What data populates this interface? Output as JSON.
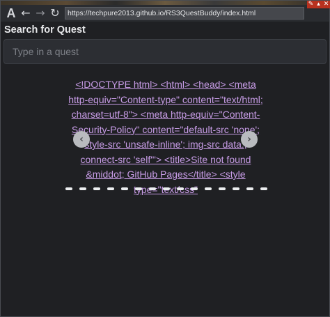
{
  "toolbar": {
    "a_label": "A",
    "back_glyph": "←",
    "forward_glyph": "→",
    "reload_glyph": "↻",
    "url": "https://techpure2013.github.io/RS3QuestBuddy/index.html",
    "pin_glyph": "✎",
    "min_glyph": "▴",
    "close_glyph": "✕",
    "icons": [
      "a-icon",
      "back-arrow-icon",
      "forward-arrow-icon",
      "reload-icon",
      "pin-icon",
      "minimize-icon",
      "close-icon"
    ]
  },
  "page": {
    "title": "Search for Quest",
    "search_placeholder": "Type in a quest",
    "search_value": ""
  },
  "carousel": {
    "content_text": "<!DOCTYPE html> <html> <head> <meta http-equiv=\"Content-type\" content=\"text/html; charset=utf-8\"> <meta http-equiv=\"Content-Security-Policy\" content=\"default-src 'none'; style-src 'unsafe-inline'; img-src data:; connect-src 'self'\"> <title>Site not found &middot; GitHub Pages</title> <style type=\"text/css\"",
    "prev_glyph": "‹",
    "next_glyph": "›",
    "slide_count": 15,
    "active_slide": 0
  },
  "colors": {
    "background": "#1f2023",
    "toolbar": "#2a2c30",
    "link": "#c79ce6",
    "window_control": "#b8311f"
  }
}
